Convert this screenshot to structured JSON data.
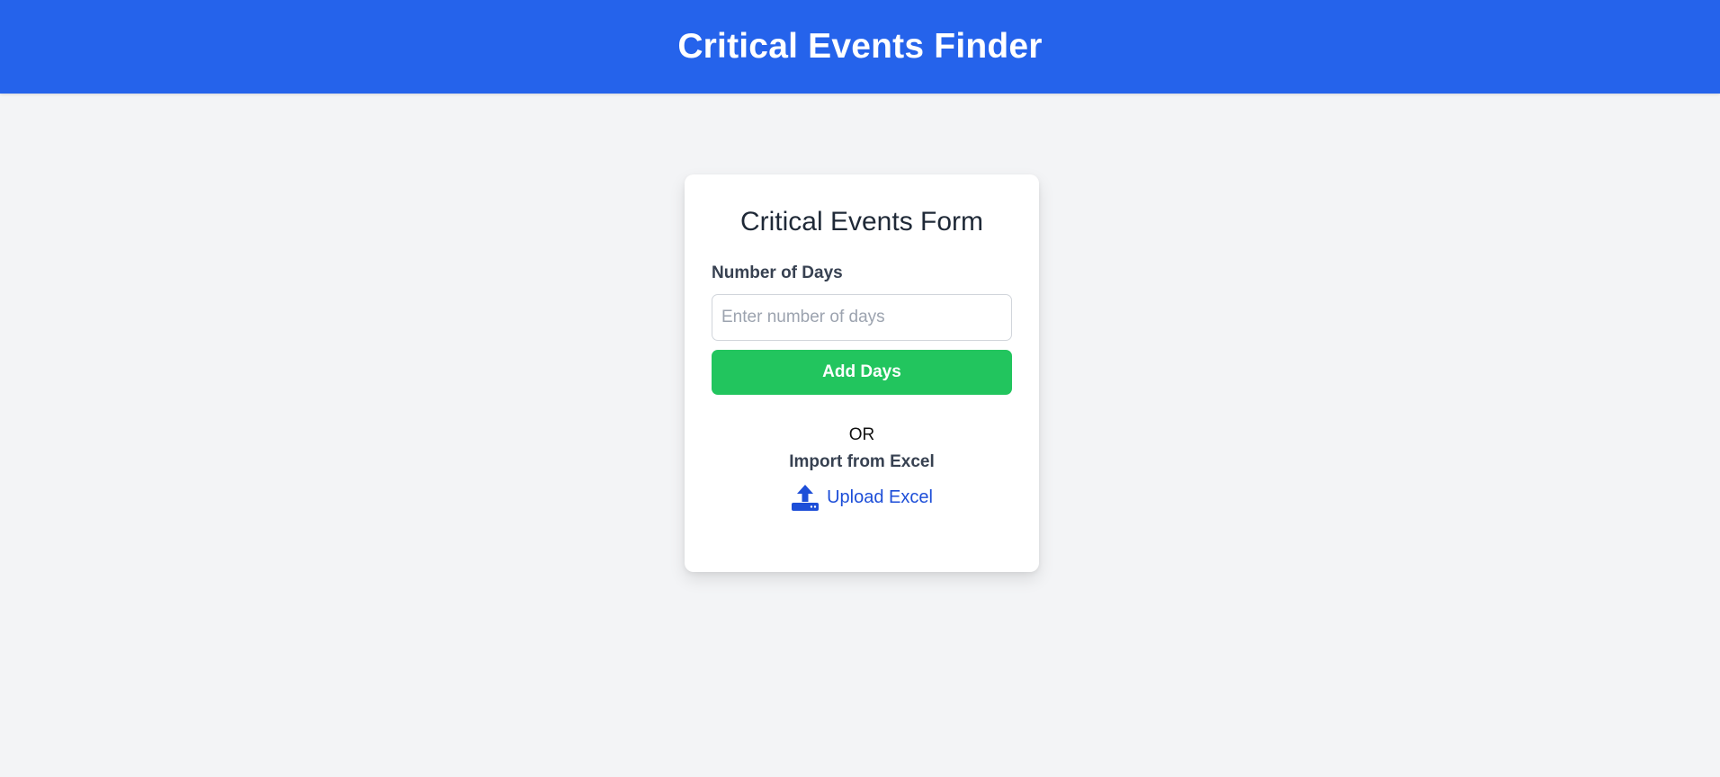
{
  "header": {
    "title": "Critical Events Finder"
  },
  "form": {
    "title": "Critical Events Form",
    "days_label": "Number of Days",
    "days_placeholder": "Enter number of days",
    "days_value": "",
    "add_button_label": "Add Days",
    "or_text": "OR",
    "import_label": "Import from Excel",
    "upload_label": "Upload Excel",
    "upload_icon": "upload-tray-icon"
  },
  "colors": {
    "header_bg": "#2563eb",
    "add_button_bg": "#22c55e",
    "link": "#1d4ed8",
    "page_bg": "#f3f4f6"
  }
}
